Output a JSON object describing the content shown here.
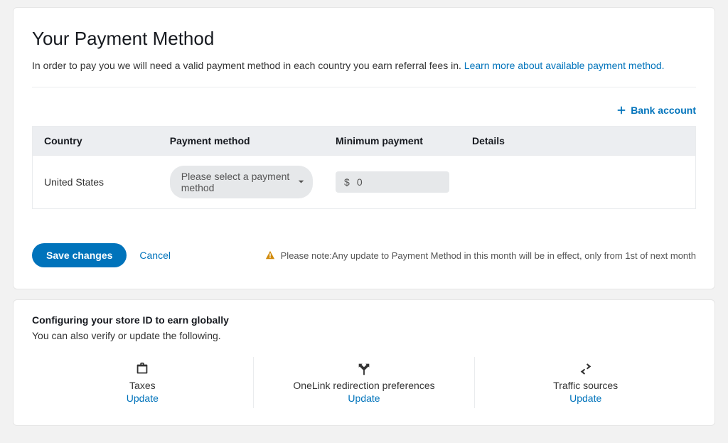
{
  "header": {
    "title": "Your Payment Method",
    "sub_prefix": "In order to pay you we will need a valid payment method in each country you earn referral fees in. ",
    "learn_more": "Learn more about available payment method."
  },
  "add_bank_label": "Bank account",
  "table": {
    "headers": {
      "country": "Country",
      "payment_method": "Payment method",
      "minimum": "Minimum payment",
      "details": "Details"
    },
    "row": {
      "country": "United States",
      "select_placeholder": "Please select a payment method",
      "currency_symbol": "$",
      "min_value": "0",
      "details": ""
    }
  },
  "actions": {
    "save": "Save changes",
    "cancel": "Cancel"
  },
  "notice": "Please note:Any update to Payment Method in this month will be in effect, only from 1st of next month",
  "store": {
    "title": "Configuring your store ID to earn globally",
    "sub": "You can also verify or update the following.",
    "update_label": "Update",
    "items": {
      "taxes": "Taxes",
      "onelink": "OneLink redirection preferences",
      "traffic": "Traffic sources"
    }
  }
}
